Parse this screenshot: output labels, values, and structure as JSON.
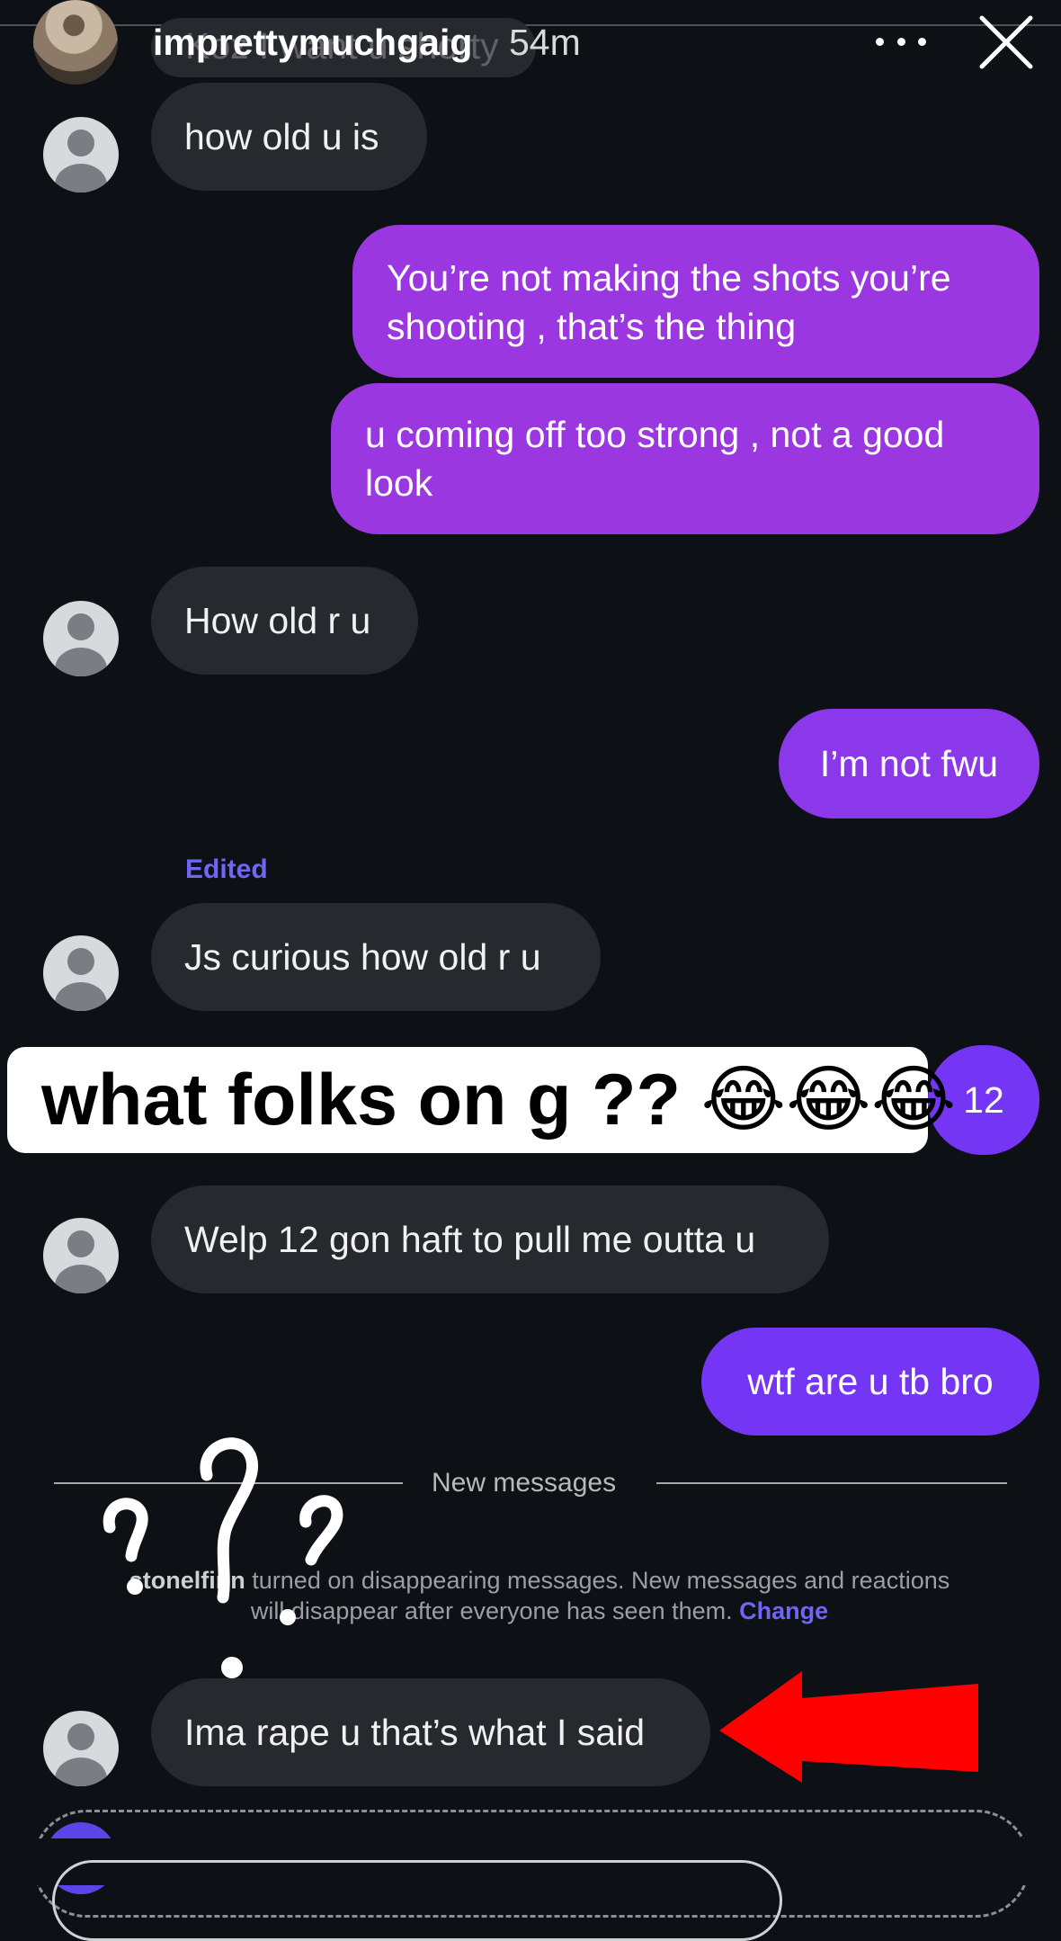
{
  "story": {
    "username": "imprettymuchgaig",
    "time": "54m"
  },
  "thread": {
    "partial_top_text": "Koz I want u shorty",
    "messages": [
      {
        "id": "m1",
        "from": "them",
        "text": "how old u is"
      },
      {
        "id": "m2",
        "from": "me",
        "lines": [
          "You’re not making the shots you’re",
          "shooting , that’s the thing"
        ]
      },
      {
        "id": "m3",
        "from": "me",
        "lines": [
          "u coming off too strong , not a good",
          "look"
        ]
      },
      {
        "id": "m4",
        "from": "them",
        "text": "How old r u"
      },
      {
        "id": "m5",
        "from": "me",
        "text": "I’m not fwu"
      },
      {
        "id": "m6",
        "from": "them",
        "text": "Js curious how old r u",
        "label": "Edited"
      },
      {
        "id": "m7",
        "from": "me",
        "text": "12"
      },
      {
        "id": "m8",
        "from": "them",
        "text": "Welp 12 gon haft to pull me outta u"
      },
      {
        "id": "m9",
        "from": "me",
        "text": "wtf are u tb bro"
      },
      {
        "id": "m10",
        "from": "them",
        "text": "Ima rape u that’s what I said"
      }
    ],
    "new_messages_label": "New messages",
    "notice": {
      "user": "stonelfinn",
      "text": "turned on disappearing messages. New messages and reactions will disappear after everyone has seen them.",
      "action": "Change"
    }
  },
  "overlay": {
    "caption": "what folks on g ?? 😂😂😂"
  },
  "colors": {
    "background": "#0d1015",
    "incoming_bubble": "#26292e",
    "outgoing_purple": "#9b37e0",
    "outgoing_violet": "#7436f4",
    "accent": "#6f66f4",
    "arrow": "#ff0000"
  },
  "icons": [
    "more-icon",
    "close-icon",
    "avatar",
    "question-marks-drawing",
    "red-arrow-drawing"
  ]
}
